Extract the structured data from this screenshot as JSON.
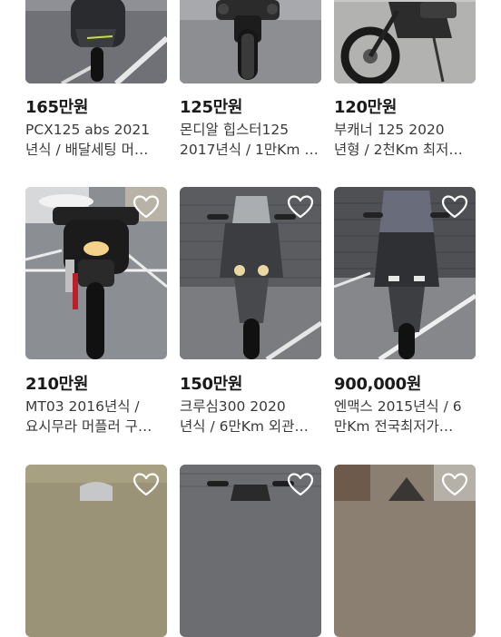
{
  "listings": [
    {
      "price": "165만원",
      "title_line1": "PCX125 abs 2021",
      "title_line2": "년식 / 배달세팅 머…"
    },
    {
      "price": "125만원",
      "title_line1": "몬디알 힙스터125",
      "title_line2": "2017년식 / 1만Km …"
    },
    {
      "price": "120만원",
      "title_line1": "부캐너 125 2020",
      "title_line2": "년형 / 2천Km 최저…"
    },
    {
      "price": "210만원",
      "title_line1": "MT03 2016년식 /",
      "title_line2": "요시무라 머플러 구…"
    },
    {
      "price": "150만원",
      "title_line1": "크루심300 2020",
      "title_line2": "년식 / 6만Km 외관…"
    },
    {
      "price": "900,000원",
      "title_line1": "엔맥스 2015년식 / 6",
      "title_line2": "만Km 전국최저가…"
    }
  ],
  "icons": {
    "favorite": "heart-outline-icon"
  },
  "colors": {
    "text": "#1a1a1a",
    "subtext": "#3a3a3a",
    "heart_stroke": "#ffffff"
  }
}
